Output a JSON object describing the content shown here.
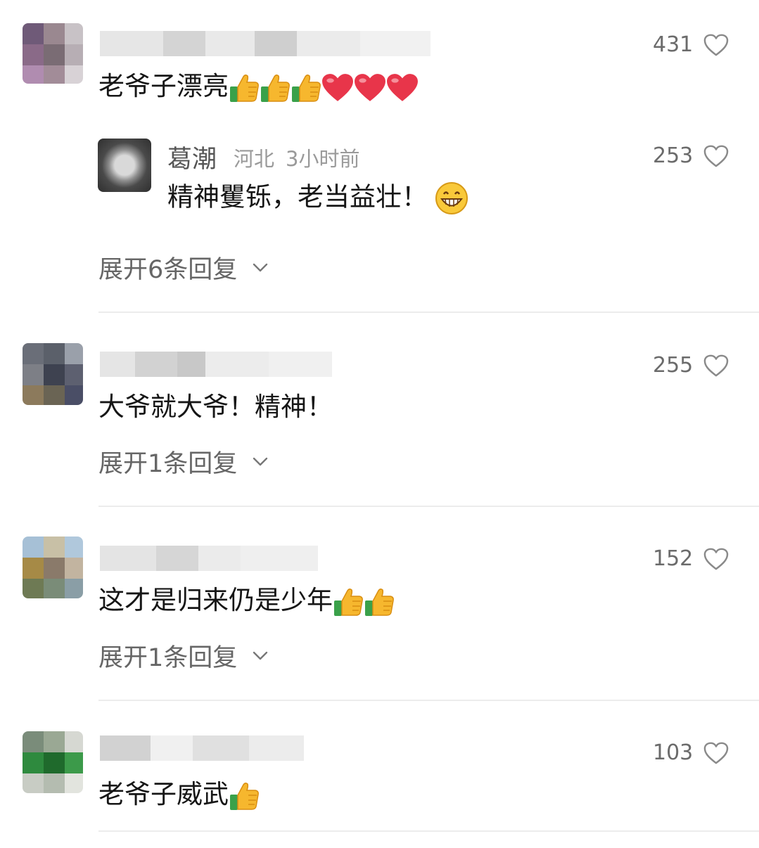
{
  "comments": [
    {
      "text": "老爷子漂亮",
      "emojis": [
        "thumbs-up",
        "thumbs-up",
        "thumbs-up",
        "red-heart",
        "red-heart",
        "red-heart"
      ],
      "likes": "431",
      "reply": {
        "name": "葛潮",
        "location": "河北",
        "time": "3小时前",
        "text": "精神矍铄，老当益壮！",
        "emoji": "grinning-face",
        "likes": "253"
      },
      "expand": "展开6条回复"
    },
    {
      "text": "大爷就大爷！精神！",
      "emojis": [],
      "likes": "255",
      "expand": "展开1条回复"
    },
    {
      "text": "这才是归来仍是少年",
      "emojis": [
        "thumbs-up",
        "thumbs-up"
      ],
      "likes": "152",
      "expand": "展开1条回复"
    },
    {
      "text": "老爷子威武",
      "emojis": [
        "thumbs-up"
      ],
      "likes": "103"
    }
  ],
  "colors": {
    "heart": "#e8354a",
    "thumb": "#f6b72e",
    "cuff": "#3aa14a",
    "text": "#161616",
    "muted": "#666666"
  }
}
